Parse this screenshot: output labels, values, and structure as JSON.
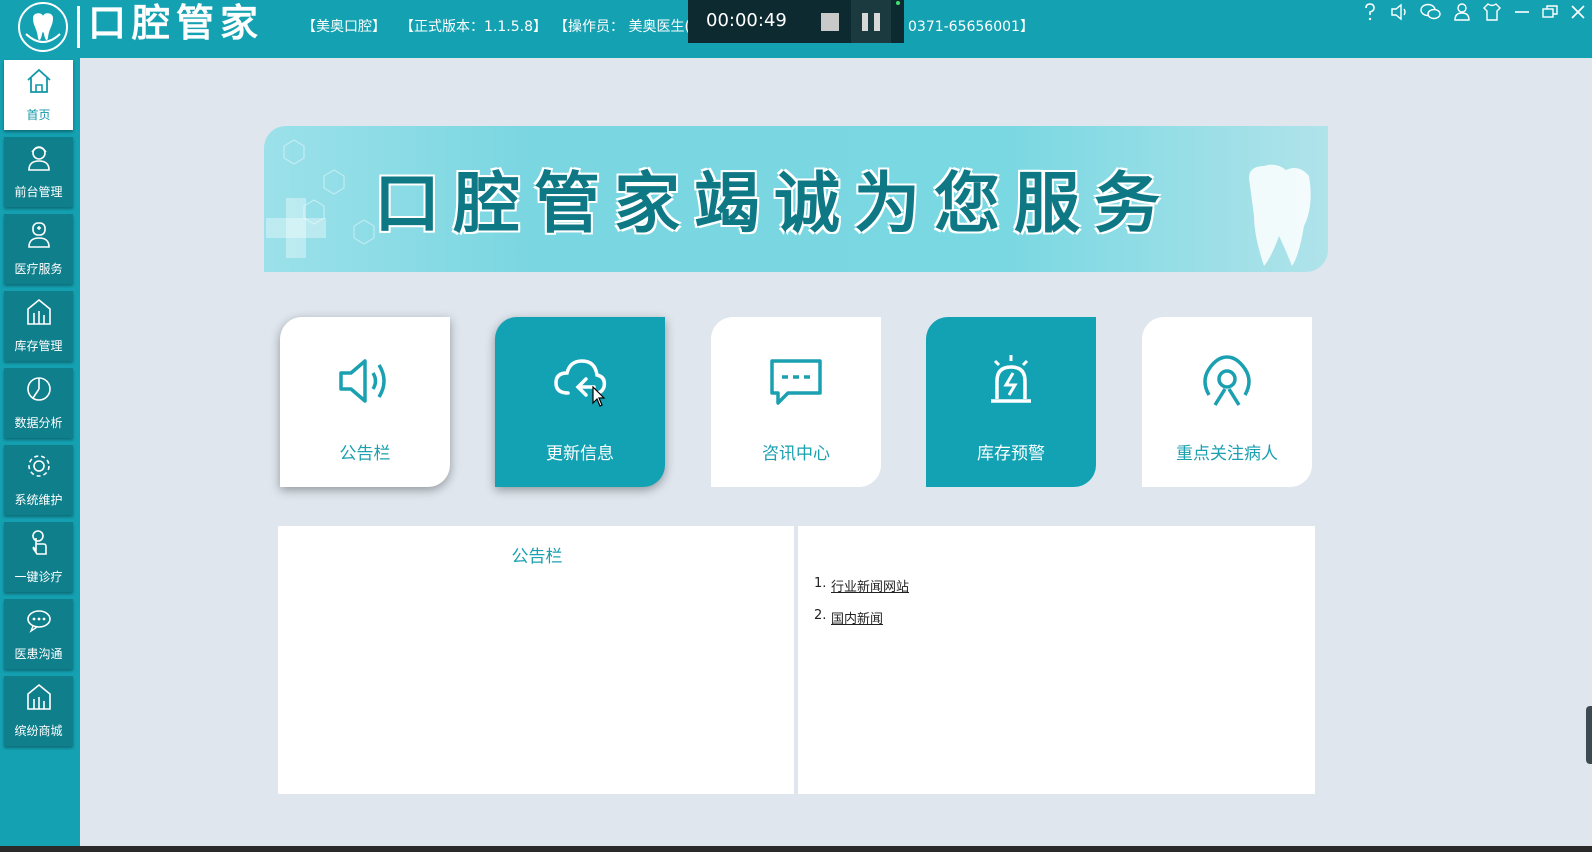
{
  "header": {
    "brand": "口腔管家",
    "clinic": "【美奥口腔】",
    "version": "【正式版本：1.1.5.8】",
    "operator": "【操作员： 美奥医生(",
    "phone": "0371-65656001】"
  },
  "recorder": {
    "time": "00:00:49"
  },
  "window_icons": [
    "help-icon",
    "mute-icon",
    "wechat-icon",
    "user-icon",
    "skin-icon",
    "minimize-icon",
    "restore-icon",
    "close-icon"
  ],
  "sidebar": {
    "items": [
      {
        "label": "首页",
        "icon": "home-icon",
        "active": true
      },
      {
        "label": "前台管理",
        "icon": "receptionist-icon"
      },
      {
        "label": "医疗服务",
        "icon": "doctor-icon"
      },
      {
        "label": "库存管理",
        "icon": "warehouse-icon"
      },
      {
        "label": "数据分析",
        "icon": "pie-chart-icon"
      },
      {
        "label": "系统维护",
        "icon": "settings-icon"
      },
      {
        "label": "一键诊疗",
        "icon": "touch-icon"
      },
      {
        "label": "医患沟通",
        "icon": "chat-icon"
      },
      {
        "label": "缤纷商城",
        "icon": "store-icon"
      }
    ]
  },
  "banner": {
    "title": "口腔管家竭诚为您服务"
  },
  "cards": [
    {
      "label": "公告栏",
      "icon": "speaker-icon"
    },
    {
      "label": "更新信息",
      "icon": "cloud-update-icon"
    },
    {
      "label": "咨讯中心",
      "icon": "message-icon"
    },
    {
      "label": "库存预警",
      "icon": "alarm-icon"
    },
    {
      "label": "重点关注病人",
      "icon": "target-person-icon"
    }
  ],
  "notice_panel": {
    "title": "公告栏"
  },
  "news_panel": {
    "items": [
      {
        "num": "1.",
        "label": "行业新闻网站"
      },
      {
        "num": "2.",
        "label": "国内新闻"
      }
    ]
  },
  "colors": {
    "primary": "#14a2b3",
    "sidebar_item": "#0f7f8c",
    "background": "#dfe6ee",
    "banner_text": "#0f7885"
  }
}
